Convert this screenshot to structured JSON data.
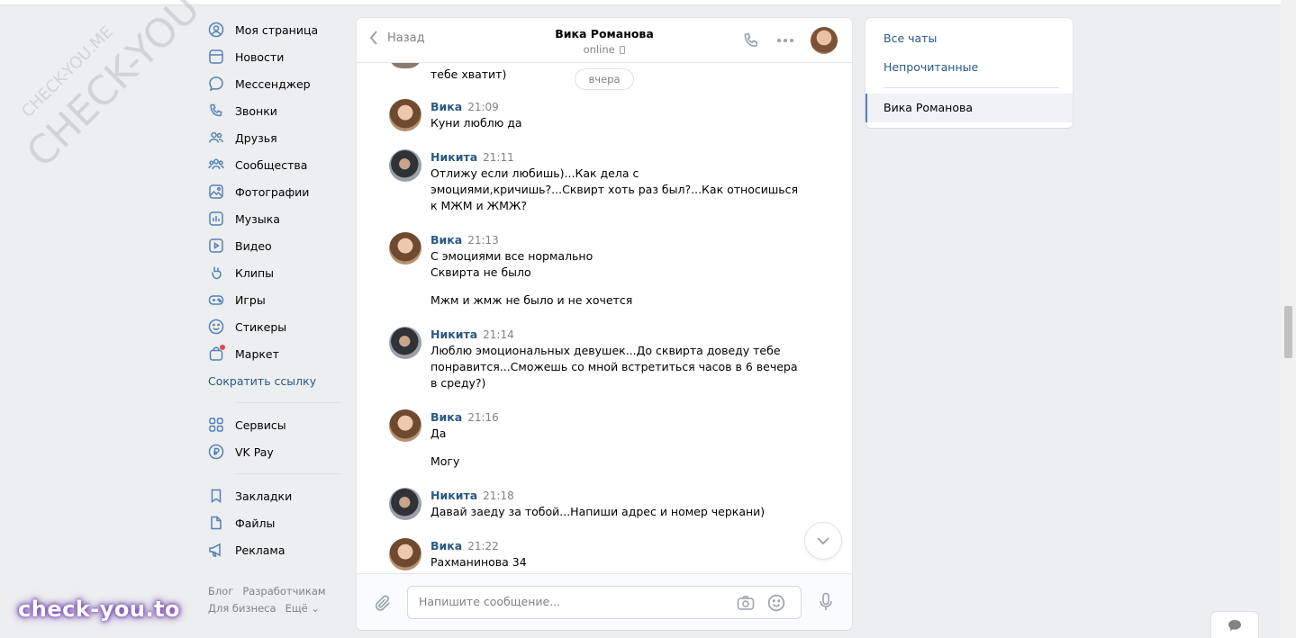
{
  "nav": {
    "items": [
      {
        "label": "Моя страница",
        "icon": "user-circle-icon"
      },
      {
        "label": "Новости",
        "icon": "news-icon"
      },
      {
        "label": "Мессенджер",
        "icon": "message-icon"
      },
      {
        "label": "Звонки",
        "icon": "phone-icon"
      },
      {
        "label": "Друзья",
        "icon": "friends-icon"
      },
      {
        "label": "Сообщества",
        "icon": "communities-icon"
      },
      {
        "label": "Фотографии",
        "icon": "photo-icon"
      },
      {
        "label": "Музыка",
        "icon": "music-icon"
      },
      {
        "label": "Видео",
        "icon": "video-icon"
      },
      {
        "label": "Клипы",
        "icon": "clips-icon"
      },
      {
        "label": "Игры",
        "icon": "gamepad-icon"
      },
      {
        "label": "Стикеры",
        "icon": "smile-icon"
      },
      {
        "label": "Маркет",
        "icon": "market-icon"
      }
    ],
    "shorten_link": "Сократить ссылку",
    "services": [
      {
        "label": "Сервисы",
        "icon": "services-icon"
      },
      {
        "label": "VK Pay",
        "icon": "vkpay-icon"
      }
    ],
    "extra": [
      {
        "label": "Закладки",
        "icon": "bookmark-icon"
      },
      {
        "label": "Файлы",
        "icon": "file-icon"
      },
      {
        "label": "Реклама",
        "icon": "megaphone-icon"
      }
    ]
  },
  "footer": {
    "blog": "Блог",
    "developers": "Разработчикам",
    "business": "Для бизнеса",
    "more": "Ещё ⌄"
  },
  "watermark": {
    "large": "CHECK-YOU.ME",
    "small": "CHECK-YOU.ME",
    "brand": "check-you.to"
  },
  "chat": {
    "back_label": "Назад",
    "peer_name": "Вика Романова",
    "peer_status": "online",
    "date_label": "вчера",
    "prev_line": "тебе хватит)",
    "messages": [
      {
        "author": "Вика",
        "time": "21:09",
        "lines": [
          "Куни люблю да"
        ]
      },
      {
        "author": "Никита",
        "time": "21:11",
        "lines": [
          "Отлижу если любишь)...Как дела с",
          "эмоциями,кричишь?...Сквирт хоть раз был?...Как относишься",
          "к МЖМ и ЖМЖ?"
        ]
      },
      {
        "author": "Вика",
        "time": "21:13",
        "lines": [
          "С эмоциями все нормально",
          "Сквирта не было",
          "Мжм и жмж не было и не хочется"
        ]
      },
      {
        "author": "Никита",
        "time": "21:14",
        "lines": [
          "Люблю эмоциональных девушек...До сквирта доведу тебе",
          "понравится...Сможешь со мной встретиться часов в 6 вечера",
          "в среду?)"
        ]
      },
      {
        "author": "Вика",
        "time": "21:16",
        "lines": [
          "Да",
          "Могу"
        ]
      },
      {
        "author": "Никита",
        "time": "21:18",
        "lines": [
          "Давай заеду за тобой...Напиши адрес и номер черкани)"
        ]
      },
      {
        "author": "Вика",
        "time": "21:22",
        "lines": [
          "Рахманинова 34"
        ]
      }
    ],
    "composer_placeholder": "Напишите сообщение..."
  },
  "right_panel": {
    "all_chats": "Все чаты",
    "unread": "Непрочитанные",
    "active_chat": "Вика Романова"
  }
}
